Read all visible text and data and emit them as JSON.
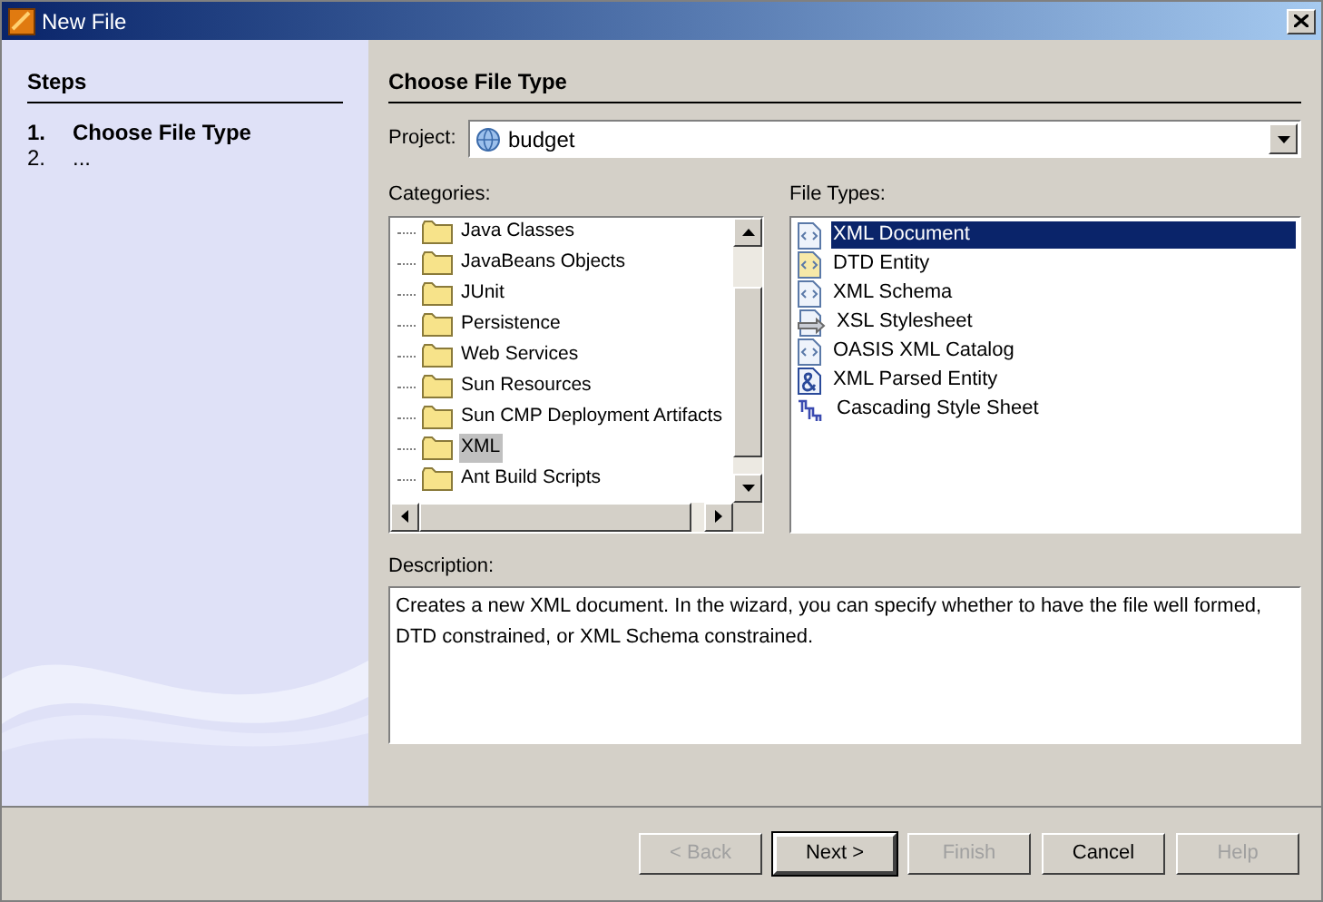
{
  "window": {
    "title": "New File"
  },
  "steps": {
    "title": "Steps",
    "items": [
      {
        "number": "1.",
        "label": "Choose File Type",
        "selected": true
      },
      {
        "number": "2.",
        "label": "...",
        "selected": false
      }
    ]
  },
  "panel": {
    "title": "Choose File Type",
    "project": {
      "label": "Project:",
      "value": "budget"
    },
    "categories": {
      "label": "Categories:",
      "items": [
        {
          "label": "Java Classes",
          "selected": false
        },
        {
          "label": "JavaBeans Objects",
          "selected": false
        },
        {
          "label": "JUnit",
          "selected": false
        },
        {
          "label": "Persistence",
          "selected": false
        },
        {
          "label": "Web Services",
          "selected": false
        },
        {
          "label": "Sun Resources",
          "selected": false
        },
        {
          "label": "Sun CMP Deployment Artifacts",
          "selected": false
        },
        {
          "label": "XML",
          "selected": true
        },
        {
          "label": "Ant Build Scripts",
          "selected": false
        }
      ]
    },
    "file_types": {
      "label": "File Types:",
      "items": [
        {
          "label": "XML Document",
          "kind": "document",
          "selected": true
        },
        {
          "label": "DTD Entity",
          "kind": "dtd",
          "selected": false
        },
        {
          "label": "XML Schema",
          "kind": "document",
          "selected": false
        },
        {
          "label": "XSL Stylesheet",
          "kind": "xsl",
          "selected": false
        },
        {
          "label": "OASIS XML Catalog",
          "kind": "document",
          "selected": false
        },
        {
          "label": "XML Parsed Entity",
          "kind": "entity",
          "selected": false
        },
        {
          "label": "Cascading Style Sheet",
          "kind": "css",
          "selected": false
        }
      ]
    },
    "description": {
      "label": "Description:",
      "text": "Creates a new XML document. In the wizard, you can specify whether to have the file well formed, DTD constrained, or XML Schema constrained."
    }
  },
  "buttons": [
    {
      "label": "< Back",
      "disabled": true,
      "default": false
    },
    {
      "label": "Next >",
      "disabled": false,
      "default": true
    },
    {
      "label": "Finish",
      "disabled": true,
      "default": false
    },
    {
      "label": "Cancel",
      "disabled": false,
      "default": false
    },
    {
      "label": "Help",
      "disabled": true,
      "default": false
    }
  ]
}
